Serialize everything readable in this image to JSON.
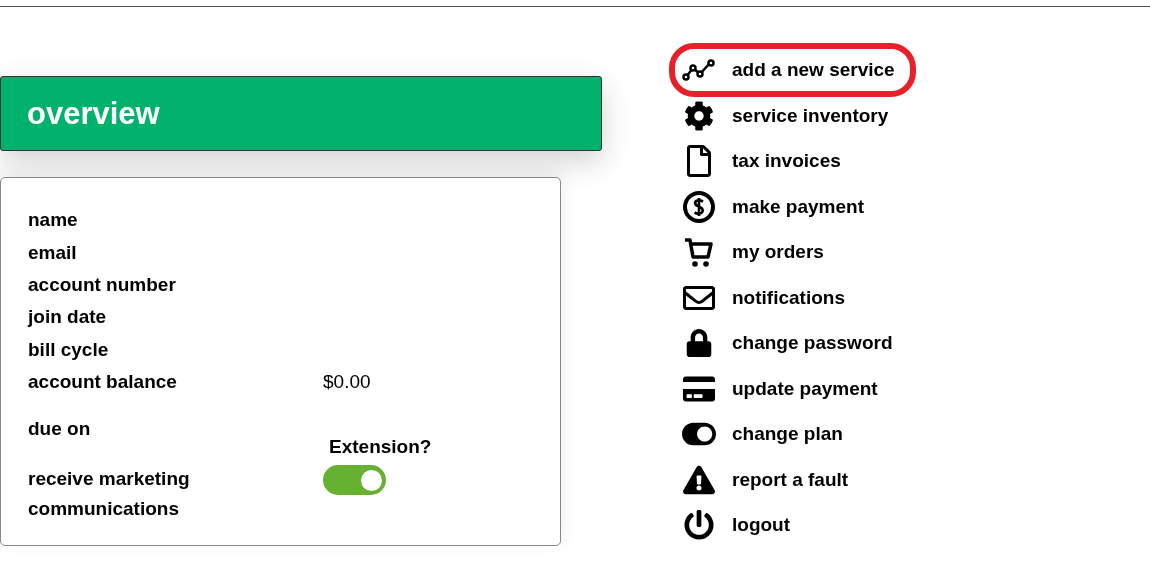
{
  "header": {
    "title": "overview"
  },
  "account": {
    "fields": [
      {
        "label": "name"
      },
      {
        "label": "email"
      },
      {
        "label": "account number"
      },
      {
        "label": "join date"
      },
      {
        "label": "bill cycle"
      },
      {
        "label": "account balance",
        "value": "$0.00"
      }
    ],
    "due_on": {
      "label": "due on",
      "extension_label": "Extension?"
    },
    "marketing": {
      "label": "receive marketing communications",
      "on": true
    }
  },
  "menu": [
    {
      "label": "add a new service",
      "selected": true
    },
    {
      "label": "service inventory",
      "selected": false
    },
    {
      "label": "tax invoices",
      "selected": false
    },
    {
      "label": "make payment",
      "selected": false
    },
    {
      "label": "my orders",
      "selected": false
    },
    {
      "label": "notifications",
      "selected": false
    },
    {
      "label": "change password",
      "selected": false
    },
    {
      "label": "update payment",
      "selected": false
    },
    {
      "label": "change plan",
      "selected": false
    },
    {
      "label": "report a fault",
      "selected": false
    },
    {
      "label": "logout",
      "selected": false
    }
  ]
}
